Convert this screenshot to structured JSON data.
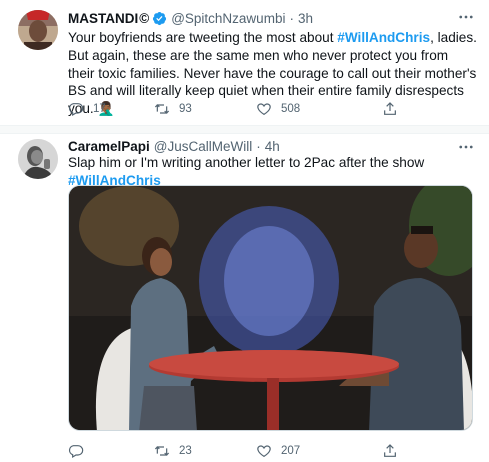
{
  "tweet1": {
    "display_name": "MASTANDI",
    "display_name_emblem": "©",
    "handle": "@SpitchNzawumbi",
    "separator": "·",
    "time": "3h",
    "text_part1": "Your boyfriends are tweeting the most about ",
    "hashtag": "#WillAndChris",
    "text_part2": ", ladies. But again, these are the same men who never protect  you from their toxic families. Never have the courage to call out their mother's BS and will literally keep quiet when their entire family disrespects you. 🤦🏾‍♂️",
    "replies": "17",
    "retweets": "93",
    "likes": "508"
  },
  "tweet2": {
    "display_name": "CaramelPapi",
    "handle": "@JusCallMeWill",
    "separator": "·",
    "time": "4h",
    "text": "Slap him or I'm writing another letter to 2Pac after the show ",
    "hashtag": "#WillAndChris",
    "replies": "",
    "retweets": "23",
    "likes": "207"
  },
  "colors": {
    "accent": "#1d9bf0",
    "secondary_text": "#536471",
    "primary_text": "#0f1419"
  },
  "icons": [
    "verified-badge-icon",
    "more-options-icon",
    "reply-icon",
    "retweet-icon",
    "like-icon",
    "share-icon"
  ]
}
